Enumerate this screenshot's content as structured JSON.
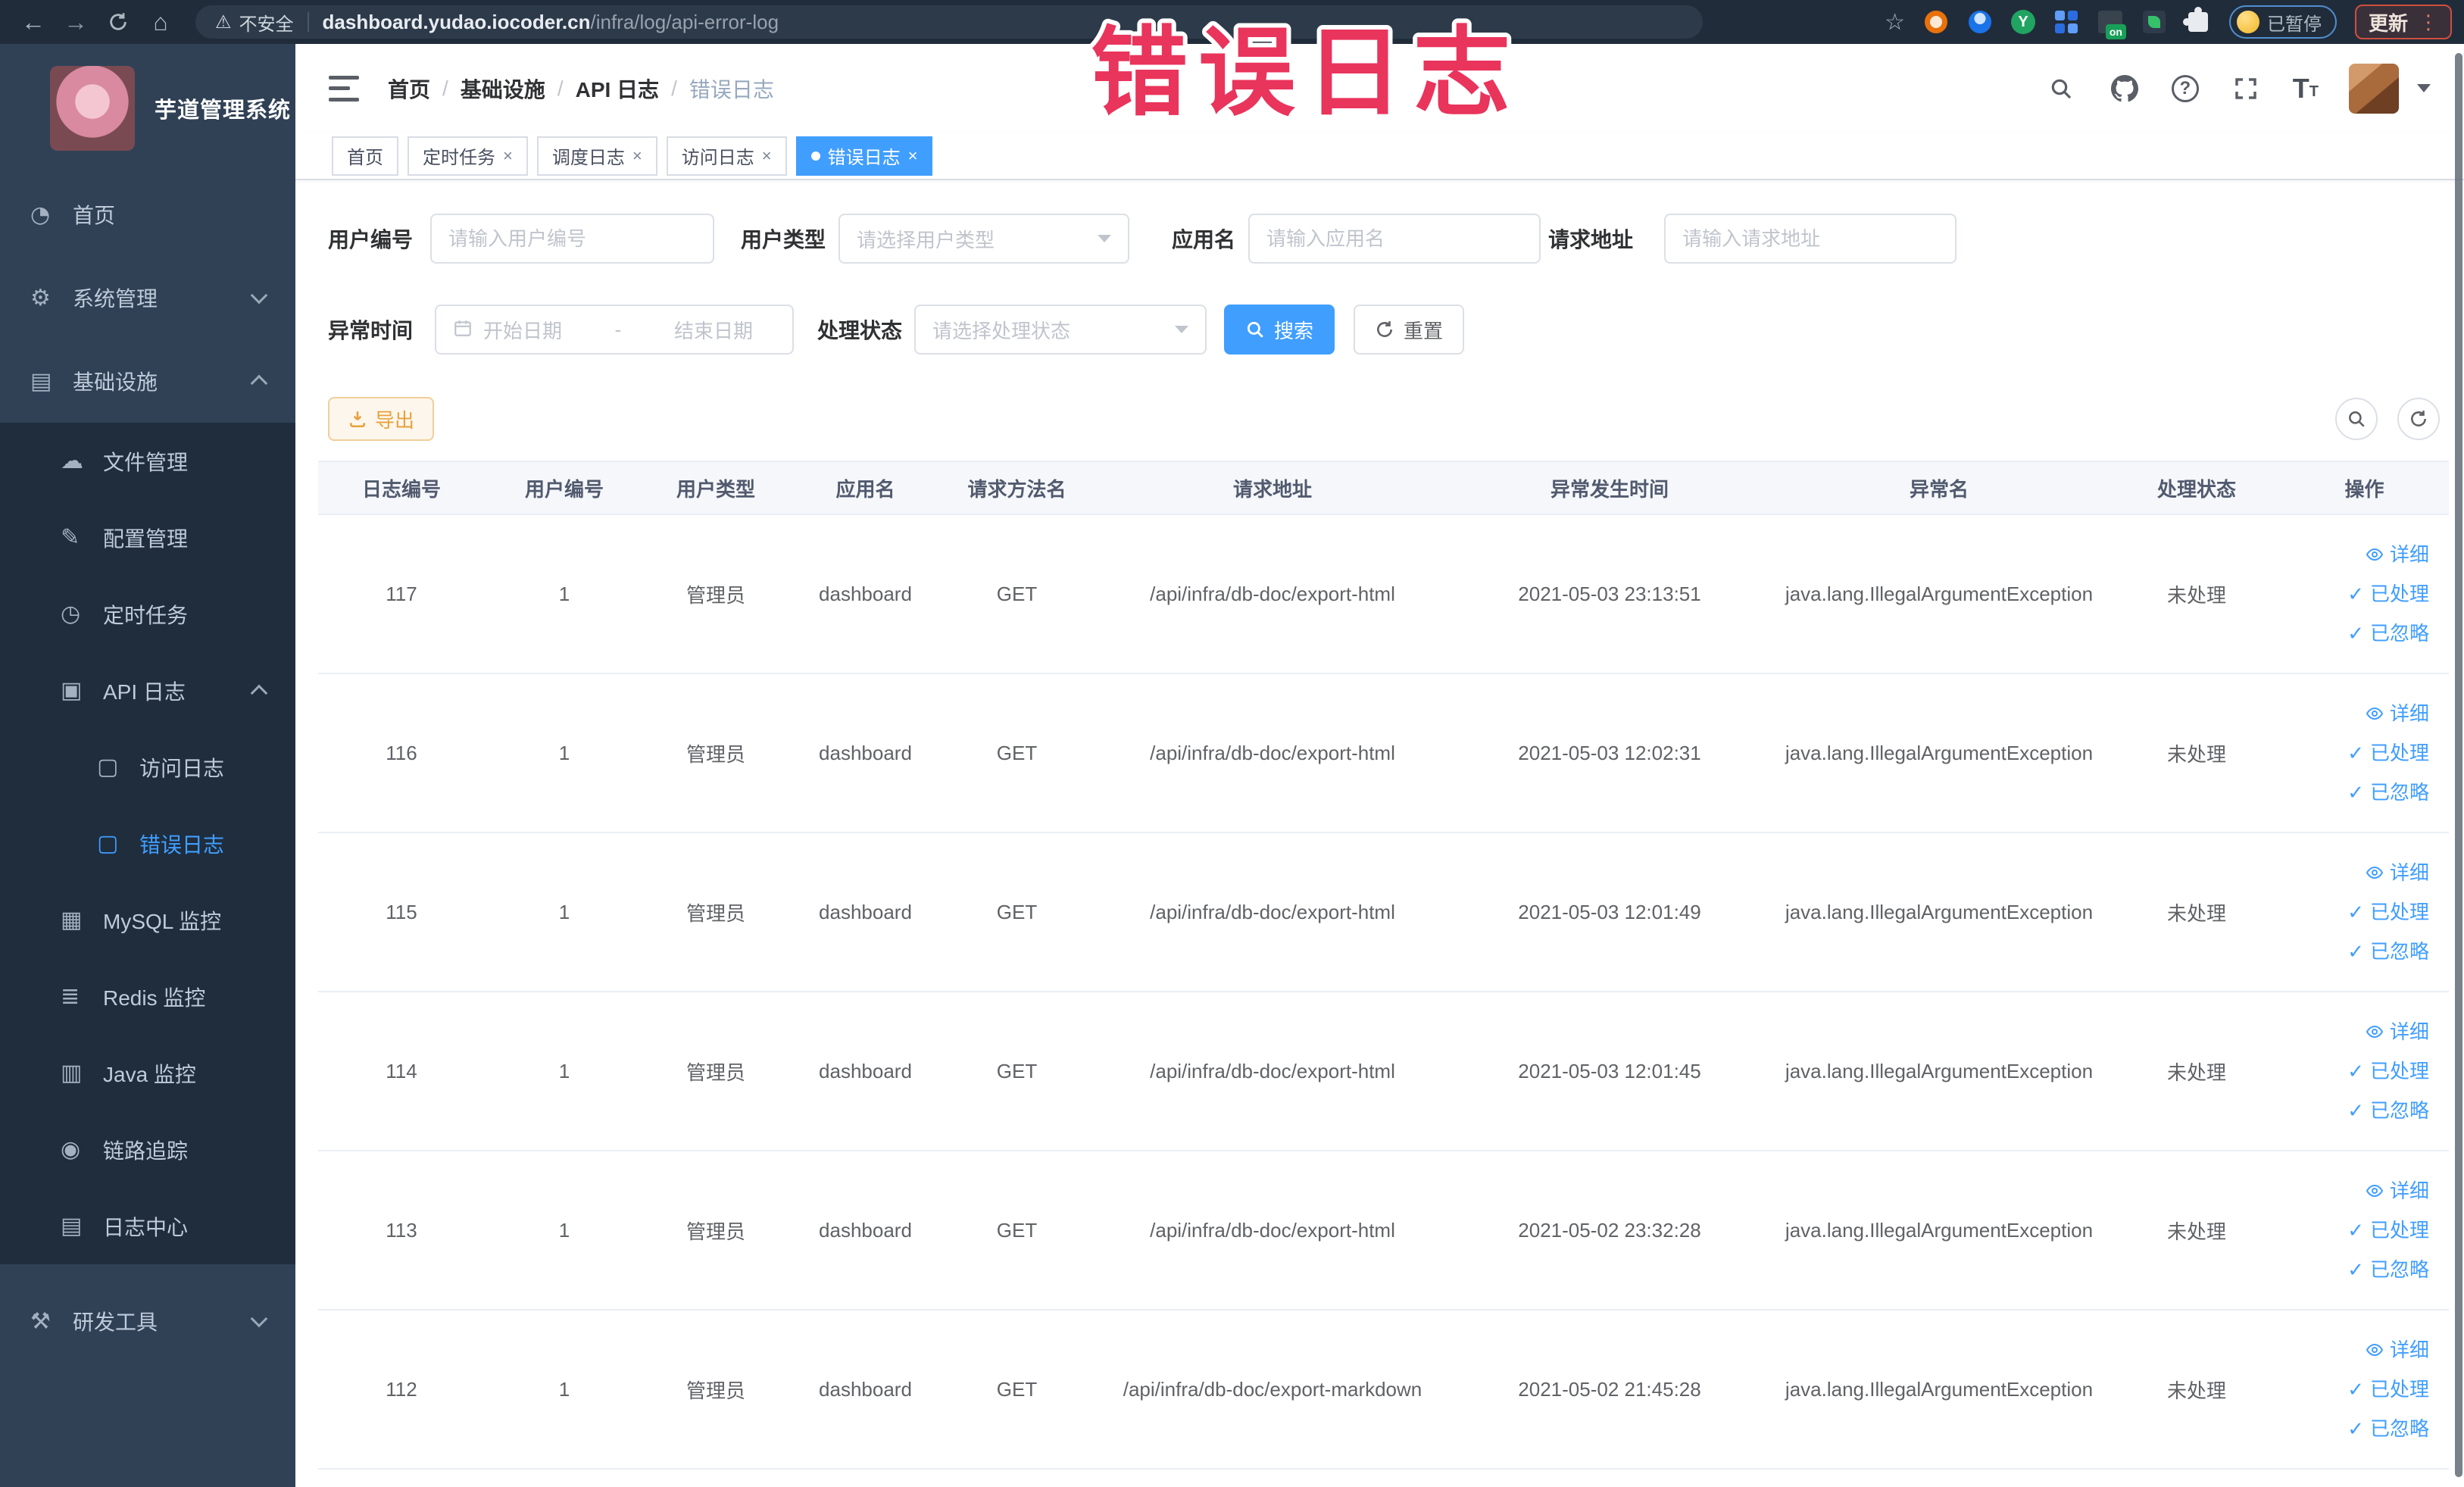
{
  "browser": {
    "security_chip": "不安全",
    "url_host": "dashboard.yudao.iocoder.cn",
    "url_path": "/infra/log/api-error-log",
    "paused_label": "已暂停",
    "update_label": "更新"
  },
  "annotation": {
    "text": "错误日志",
    "color": "#e9345c"
  },
  "colors": {
    "accent": "#409eff",
    "warning": "#e6a23c",
    "sidebar_bg": "#304156",
    "submenu_bg": "#1f2d3d"
  },
  "sidebar": {
    "title": "芋道管理系统",
    "items": [
      {
        "label": "首页",
        "icon": "dashboard-icon"
      },
      {
        "label": "系统管理",
        "icon": "gear-icon",
        "chevron": "down"
      },
      {
        "label": "基础设施",
        "icon": "monitor-icon",
        "chevron": "up"
      },
      {
        "label": "文件管理",
        "icon": "cloud-icon"
      },
      {
        "label": "配置管理",
        "icon": "edit-icon"
      },
      {
        "label": "定时任务",
        "icon": "clock-icon"
      },
      {
        "label": "API 日志",
        "icon": "log-icon",
        "chevron": "up"
      },
      {
        "label": "访问日志",
        "icon": "doc-icon"
      },
      {
        "label": "错误日志",
        "icon": "doc-icon",
        "active": true
      },
      {
        "label": "MySQL 监控",
        "icon": "chart-icon"
      },
      {
        "label": "Redis 监控",
        "icon": "layers-icon"
      },
      {
        "label": "Java 监控",
        "icon": "java-icon"
      },
      {
        "label": "链路追踪",
        "icon": "eye-icon"
      },
      {
        "label": "日志中心",
        "icon": "log-center-icon"
      },
      {
        "label": "研发工具",
        "icon": "tools-icon",
        "chevron": "down"
      }
    ]
  },
  "header": {
    "breadcrumb": [
      "首页",
      "基础设施",
      "API 日志",
      "错误日志"
    ]
  },
  "tabs": [
    {
      "label": "首页",
      "closable": false,
      "active": false
    },
    {
      "label": "定时任务",
      "closable": true,
      "active": false
    },
    {
      "label": "调度日志",
      "closable": true,
      "active": false
    },
    {
      "label": "访问日志",
      "closable": true,
      "active": false
    },
    {
      "label": "错误日志",
      "closable": true,
      "active": true
    }
  ],
  "filters": {
    "user_id": {
      "label": "用户编号",
      "placeholder": "请输入用户编号"
    },
    "user_type": {
      "label": "用户类型",
      "placeholder": "请选择用户类型"
    },
    "app_name": {
      "label": "应用名",
      "placeholder": "请输入应用名"
    },
    "request_url": {
      "label": "请求地址",
      "placeholder": "请输入请求地址"
    },
    "exception_time": {
      "label": "异常时间",
      "start_placeholder": "开始日期",
      "separator": "-",
      "end_placeholder": "结束日期"
    },
    "process_status": {
      "label": "处理状态",
      "placeholder": "请选择处理状态"
    },
    "search_label": "搜索",
    "reset_label": "重置"
  },
  "toolbar": {
    "export_label": "导出"
  },
  "table": {
    "columns": [
      "日志编号",
      "用户编号",
      "用户类型",
      "应用名",
      "请求方法名",
      "请求地址",
      "异常发生时间",
      "异常名",
      "处理状态",
      "操作"
    ],
    "row_actions": [
      "详细",
      "已处理",
      "已忽略"
    ],
    "rows": [
      {
        "id": "117",
        "user_id": "1",
        "user_type": "管理员",
        "app_name": "dashboard",
        "method": "GET",
        "url": "/api/infra/db-doc/export-html",
        "time": "2021-05-03 23:13:51",
        "exception": "java.lang.IllegalArgumentException",
        "status": "未处理"
      },
      {
        "id": "116",
        "user_id": "1",
        "user_type": "管理员",
        "app_name": "dashboard",
        "method": "GET",
        "url": "/api/infra/db-doc/export-html",
        "time": "2021-05-03 12:02:31",
        "exception": "java.lang.IllegalArgumentException",
        "status": "未处理"
      },
      {
        "id": "115",
        "user_id": "1",
        "user_type": "管理员",
        "app_name": "dashboard",
        "method": "GET",
        "url": "/api/infra/db-doc/export-html",
        "time": "2021-05-03 12:01:49",
        "exception": "java.lang.IllegalArgumentException",
        "status": "未处理"
      },
      {
        "id": "114",
        "user_id": "1",
        "user_type": "管理员",
        "app_name": "dashboard",
        "method": "GET",
        "url": "/api/infra/db-doc/export-html",
        "time": "2021-05-03 12:01:45",
        "exception": "java.lang.IllegalArgumentException",
        "status": "未处理"
      },
      {
        "id": "113",
        "user_id": "1",
        "user_type": "管理员",
        "app_name": "dashboard",
        "method": "GET",
        "url": "/api/infra/db-doc/export-html",
        "time": "2021-05-02 23:32:28",
        "exception": "java.lang.IllegalArgumentException",
        "status": "未处理"
      },
      {
        "id": "112",
        "user_id": "1",
        "user_type": "管理员",
        "app_name": "dashboard",
        "method": "GET",
        "url": "/api/infra/db-doc/export-markdown",
        "time": "2021-05-02 21:45:28",
        "exception": "java.lang.IllegalArgumentException",
        "status": "未处理"
      }
    ]
  }
}
